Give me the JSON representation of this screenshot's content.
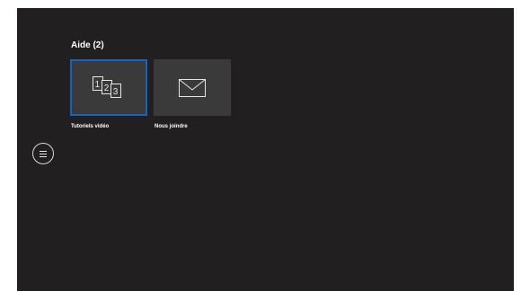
{
  "section": {
    "title": "Aide (2)"
  },
  "tiles": [
    {
      "icon": "numbered-pages-icon",
      "label": "Tutoriels vidéo",
      "focused": true,
      "glyphs": [
        "1",
        "2",
        "3"
      ]
    },
    {
      "icon": "envelope-icon",
      "label": "Nous joindre",
      "focused": false
    }
  ],
  "menu": {
    "icon": "hamburger-menu-icon"
  },
  "colors": {
    "background": "#211f20",
    "tile": "#3a3a3a",
    "focus_border": "#1565c0",
    "text": "#ffffff"
  }
}
